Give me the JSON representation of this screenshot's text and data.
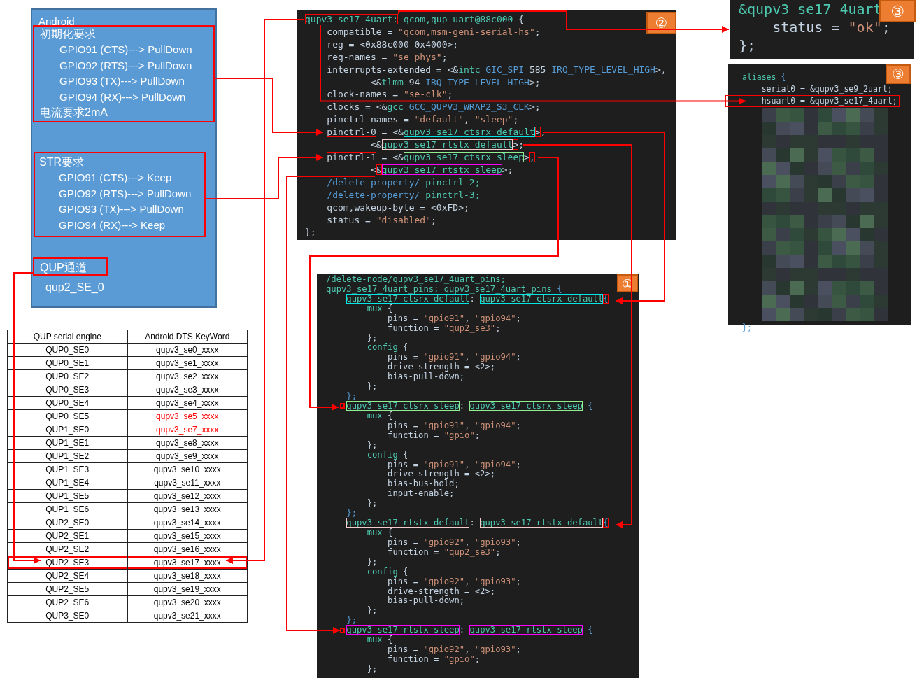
{
  "android_panel": {
    "title": "Android",
    "init_section": {
      "heading": "初期化要求",
      "items": [
        "GPIO91 (CTS)---> PullDown",
        "GPIO92 (RTS)---> PullDown",
        "GPIO93 (TX)---> PullDown",
        "GPIO94 (RX)---> PullDown"
      ],
      "footer": "电流要求2mA"
    },
    "str_section": {
      "heading": "STR要求",
      "items": [
        "GPIO91 (CTS)---> Keep",
        "GPIO92 (RTS)---> PullDown",
        "GPIO93 (TX)---> PullDown",
        "GPIO94 (RX)---> Keep"
      ]
    },
    "qup_label": "QUP通道",
    "qup_value": "qup2_SE_0"
  },
  "qup_table": {
    "columns": [
      "QUP serial engine",
      "Android DTS KeyWord"
    ],
    "rows": [
      {
        "engine": "QUP0_SE0",
        "keyword": "qupv3_se0_xxxx",
        "color": "#000000",
        "marked": false
      },
      {
        "engine": "QUP0_SE1",
        "keyword": "qupv3_se1_xxxx",
        "color": "#000000",
        "marked": false
      },
      {
        "engine": "QUP0_SE2",
        "keyword": "qupv3_se2_xxxx",
        "color": "#000000",
        "marked": false
      },
      {
        "engine": "QUP0_SE3",
        "keyword": "qupv3_se3_xxxx",
        "color": "#000000",
        "marked": false
      },
      {
        "engine": "QUP0_SE4",
        "keyword": "qupv3_se4_xxxx",
        "color": "#000000",
        "marked": false
      },
      {
        "engine": "QUP0_SE5",
        "keyword": "qupv3_se5_xxxx",
        "color": "#ff0000",
        "marked": false
      },
      {
        "engine": "QUP1_SE0",
        "keyword": "qupv3_se7_xxxx",
        "color": "#ff0000",
        "marked": false
      },
      {
        "engine": "QUP1_SE1",
        "keyword": "qupv3_se8_xxxx",
        "color": "#000000",
        "marked": false
      },
      {
        "engine": "QUP1_SE2",
        "keyword": "qupv3_se9_xxxx",
        "color": "#000000",
        "marked": false
      },
      {
        "engine": "QUP1_SE3",
        "keyword": "qupv3_se10_xxxx",
        "color": "#000000",
        "marked": false
      },
      {
        "engine": "QUP1_SE4",
        "keyword": "qupv3_se11_xxxx",
        "color": "#000000",
        "marked": false
      },
      {
        "engine": "QUP1_SE5",
        "keyword": "qupv3_se12_xxxx",
        "color": "#000000",
        "marked": false
      },
      {
        "engine": "QUP1_SE6",
        "keyword": "qupv3_se13_xxxx",
        "color": "#000000",
        "marked": false
      },
      {
        "engine": "QUP2_SE0",
        "keyword": "qupv3_se14_xxxx",
        "color": "#000000",
        "marked": false
      },
      {
        "engine": "QUP2_SE1",
        "keyword": "qupv3_se15_xxxx",
        "color": "#000000",
        "marked": false
      },
      {
        "engine": "QUP2_SE2",
        "keyword": "qupv3_se16_xxxx",
        "color": "#000000",
        "marked": false
      },
      {
        "engine": "QUP2_SE3",
        "keyword": "qupv3_se17_xxxx",
        "color": "#000000",
        "marked": true
      },
      {
        "engine": "QUP2_SE4",
        "keyword": "qupv3_se18_xxxx",
        "color": "#000000",
        "marked": false
      },
      {
        "engine": "QUP2_SE5",
        "keyword": "qupv3_se19_xxxx",
        "color": "#000000",
        "marked": false
      },
      {
        "engine": "QUP2_SE6",
        "keyword": "qupv3_se20_xxxx",
        "color": "#000000",
        "marked": false
      },
      {
        "engine": "QUP3_SE0",
        "keyword": "qupv3_se21_xxxx",
        "color": "#000000",
        "marked": false
      }
    ]
  },
  "uart_node_code": {
    "badge": "②",
    "lines": [
      [
        {
          "text": "qupv3_se17_4uart:",
          "kind": "id",
          "color": "#ff0000"
        },
        {
          "text": " qcom,qup_uart@88c000 ",
          "kind": "id"
        },
        {
          "text": "{",
          "kind": "plain"
        }
      ],
      [
        {
          "text": "    compatible = ",
          "kind": "plain"
        },
        {
          "text": "\"qcom,msm-geni-serial-hs\"",
          "kind": "str"
        },
        {
          "text": ";",
          "kind": "plain"
        }
      ],
      [
        {
          "text": "    reg = <0x88c000 0x4000>;",
          "kind": "plain"
        }
      ],
      [
        {
          "text": "    reg-names = ",
          "kind": "plain"
        },
        {
          "text": "\"se_phys\"",
          "kind": "str"
        },
        {
          "text": ";",
          "kind": "plain"
        }
      ],
      [
        {
          "text": "    interrupts-extended = <&",
          "kind": "plain"
        },
        {
          "text": "intc",
          "kind": "id"
        },
        {
          "text": " GIC_SPI ",
          "kind": "key"
        },
        {
          "text": "585",
          "kind": "plain"
        },
        {
          "text": " IRQ_TYPE_LEVEL_HIGH",
          "kind": "key"
        },
        {
          "text": ">,",
          "kind": "plain"
        }
      ],
      [
        {
          "text": "            <&",
          "kind": "plain"
        },
        {
          "text": "tlmm",
          "kind": "id"
        },
        {
          "text": " 94 ",
          "kind": "plain"
        },
        {
          "text": "IRQ_TYPE_LEVEL_HIGH",
          "kind": "key"
        },
        {
          "text": ">;",
          "kind": "plain"
        }
      ],
      [
        {
          "text": "    clock-names = ",
          "kind": "plain"
        },
        {
          "text": "\"se-clk\"",
          "kind": "str"
        },
        {
          "text": ";",
          "kind": "plain"
        }
      ],
      [
        {
          "text": "    clocks = <&",
          "kind": "plain"
        },
        {
          "text": "gcc",
          "kind": "id"
        },
        {
          "text": " GCC_QUPV3_WRAP2_S3_CLK",
          "kind": "key"
        },
        {
          "text": ">;",
          "kind": "plain"
        }
      ],
      [
        {
          "text": "    pinctrl-names = ",
          "kind": "plain"
        },
        {
          "text": "\"default\"",
          "kind": "str"
        },
        {
          "text": ", ",
          "kind": "plain"
        },
        {
          "text": "\"sleep\"",
          "kind": "str"
        },
        {
          "text": ";",
          "kind": "plain"
        }
      ],
      [
        {
          "kind": "gap"
        },
        {
          "text": "pinctrl-0",
          "kind": "plain",
          "color": "#ff0000"
        },
        {
          "text": " = <&",
          "kind": "plain"
        },
        {
          "text": "qupv3_se17_ctsrx_default",
          "kind": "id",
          "color": "#00e5e5"
        },
        {
          "text": ">",
          "kind": "plain",
          "color": "#ff0000"
        },
        {
          "text": ",",
          "kind": "plain"
        }
      ],
      [
        {
          "text": "            <&",
          "kind": "plain"
        },
        {
          "text": "qupv3_se17_rtstx_default",
          "kind": "id",
          "color": "#f4cccc"
        },
        {
          "text": ">",
          "kind": "plain",
          "color": "#ff0000"
        },
        {
          "text": ";",
          "kind": "plain"
        }
      ],
      [
        {
          "kind": "gap"
        },
        {
          "text": "pinctrl-1",
          "kind": "plain",
          "color": "#ff0000"
        },
        {
          "text": " = <&",
          "kind": "plain"
        },
        {
          "text": "qupv3_se17_ctsrx_sleep",
          "kind": "id",
          "color": "#90ee90"
        },
        {
          "text": ">",
          "kind": "plain"
        },
        {
          "text": ",",
          "kind": "plain",
          "color": "#ff0000"
        }
      ],
      [
        {
          "text": "            <",
          "kind": "plain"
        },
        {
          "text": "&",
          "kind": "plain",
          "color": "#ff0000"
        },
        {
          "text": "qupv3_se17_rtstx_sleep",
          "kind": "id",
          "color": "#ff00ff"
        },
        {
          "text": ">;",
          "kind": "plain"
        }
      ],
      [
        {
          "text": "    /delete-property/",
          "kind": "key"
        },
        {
          "text": " pinctrl-2;",
          "kind": "id"
        }
      ],
      [
        {
          "text": "    /delete-property/",
          "kind": "key"
        },
        {
          "text": " pinctrl-3;",
          "kind": "id"
        }
      ],
      [
        {
          "text": "    qcom,wakeup-byte = <0xFD>;",
          "kind": "plain"
        }
      ],
      [
        {
          "text": "    status = ",
          "kind": "plain"
        },
        {
          "text": "\"disabled\"",
          "kind": "str"
        },
        {
          "text": ";",
          "kind": "plain"
        }
      ],
      [
        {
          "text": "};",
          "kind": "plain"
        }
      ]
    ]
  },
  "status_snippet": {
    "badge": "③",
    "lines": [
      [
        {
          "text": "&qupv3_se17_4uart",
          "kind": "id"
        }
      ],
      [
        {
          "text": "    status = ",
          "kind": "plain"
        },
        {
          "text": "\"ok\"",
          "kind": "str"
        },
        {
          "text": ";",
          "kind": "plain"
        }
      ],
      [
        {
          "text": "};",
          "kind": "plain"
        }
      ]
    ]
  },
  "aliases_snippet": {
    "badge": "③",
    "lines": [
      [
        {
          "text": "aliases ",
          "kind": "id"
        },
        {
          "text": "{",
          "kind": "key"
        }
      ],
      [
        {
          "text": "    serial0 = &qupv3_se9_2uart;",
          "kind": "plain"
        }
      ],
      [
        {
          "text": "    hsuart0 = &qupv3_se17_4uart;",
          "kind": "plain",
          "color": "#ff0000"
        }
      ]
    ],
    "closing": "};"
  },
  "pins_code": {
    "badge": "①",
    "lines": [
      [
        {
          "text": "/delete-node/qupv3_se17_4uart_pins;",
          "kind": "id"
        }
      ],
      [
        {
          "text": "qupv3_se17_4uart_pins: qupv3_se17_4uart_pins ",
          "kind": "id"
        },
        {
          "text": "{",
          "kind": "key"
        }
      ],
      [
        {
          "kind": "gap"
        },
        {
          "text": "qupv3_se17_ctsrx_default",
          "kind": "id",
          "color": "#00e5e5"
        },
        {
          "text": ": ",
          "kind": "plain"
        },
        {
          "text": "qupv3_se17_ctsrx_default",
          "kind": "id",
          "color": "#00e5e5"
        },
        {
          "text": "{",
          "kind": "key",
          "color": "#ff0000"
        }
      ],
      [
        {
          "text": "        mux ",
          "kind": "id"
        },
        {
          "text": "{",
          "kind": "plain"
        }
      ],
      [
        {
          "text": "            pins = ",
          "kind": "plain"
        },
        {
          "text": "\"gpio91\"",
          "kind": "str"
        },
        {
          "text": ", ",
          "kind": "plain"
        },
        {
          "text": "\"gpio94\"",
          "kind": "str"
        },
        {
          "text": ";",
          "kind": "plain"
        }
      ],
      [
        {
          "text": "            function = ",
          "kind": "plain"
        },
        {
          "text": "\"qup2_se3\"",
          "kind": "str"
        },
        {
          "text": ";",
          "kind": "plain"
        }
      ],
      [
        {
          "text": "        };",
          "kind": "plain"
        }
      ],
      [
        {
          "text": "        config ",
          "kind": "id"
        },
        {
          "text": "{",
          "kind": "plain"
        }
      ],
      [
        {
          "text": "            pins = ",
          "kind": "plain"
        },
        {
          "text": "\"gpio91\"",
          "kind": "str"
        },
        {
          "text": ", ",
          "kind": "plain"
        },
        {
          "text": "\"gpio94\"",
          "kind": "str"
        },
        {
          "text": ";",
          "kind": "plain"
        }
      ],
      [
        {
          "text": "            drive-strength = <2>;",
          "kind": "plain"
        }
      ],
      [
        {
          "text": "            bias-pull-down;",
          "kind": "plain"
        }
      ],
      [
        {
          "text": "        };",
          "kind": "plain"
        }
      ],
      [
        {
          "text": "    };",
          "kind": "key"
        }
      ],
      [
        {
          "kind": "marker"
        },
        {
          "text": "qupv3_se17_ctsrx_sleep",
          "kind": "id",
          "color": "#90ee90"
        },
        {
          "text": ": ",
          "kind": "plain"
        },
        {
          "text": "qupv3_se17_ctsrx_sleep",
          "kind": "id",
          "color": "#90ee90"
        },
        {
          "text": " {",
          "kind": "key"
        }
      ],
      [
        {
          "text": "        mux ",
          "kind": "id"
        },
        {
          "text": "{",
          "kind": "plain"
        }
      ],
      [
        {
          "text": "            pins = ",
          "kind": "plain"
        },
        {
          "text": "\"gpio91\"",
          "kind": "str"
        },
        {
          "text": ", ",
          "kind": "plain"
        },
        {
          "text": "\"gpio94\"",
          "kind": "str"
        },
        {
          "text": ";",
          "kind": "plain"
        }
      ],
      [
        {
          "text": "            function = ",
          "kind": "plain"
        },
        {
          "text": "\"gpio\"",
          "kind": "str"
        },
        {
          "text": ";",
          "kind": "plain"
        }
      ],
      [
        {
          "text": "        };",
          "kind": "plain"
        }
      ],
      [
        {
          "text": "        config ",
          "kind": "id"
        },
        {
          "text": "{",
          "kind": "plain"
        }
      ],
      [
        {
          "text": "            pins = ",
          "kind": "plain"
        },
        {
          "text": "\"gpio91\"",
          "kind": "str"
        },
        {
          "text": ", ",
          "kind": "plain"
        },
        {
          "text": "\"gpio94\"",
          "kind": "str"
        },
        {
          "text": ";",
          "kind": "plain"
        }
      ],
      [
        {
          "text": "            drive-strength = <2>;",
          "kind": "plain"
        }
      ],
      [
        {
          "text": "            bias-bus-hold;",
          "kind": "plain"
        }
      ],
      [
        {
          "text": "            input-enable;",
          "kind": "plain"
        }
      ],
      [
        {
          "text": "        };",
          "kind": "plain"
        }
      ],
      [
        {
          "text": "    };",
          "kind": "key"
        }
      ],
      [
        {
          "kind": "gap"
        },
        {
          "text": "qupv3_se17_rtstx_default",
          "kind": "id",
          "color": "#f4cccc"
        },
        {
          "text": ": ",
          "kind": "plain"
        },
        {
          "text": "qupv3_se17_rtstx_default",
          "kind": "id",
          "color": "#f4cccc"
        },
        {
          "text": "{",
          "kind": "key",
          "color": "#ff0000"
        }
      ],
      [
        {
          "text": "        mux ",
          "kind": "id"
        },
        {
          "text": "{",
          "kind": "plain"
        }
      ],
      [
        {
          "text": "            pins = ",
          "kind": "plain"
        },
        {
          "text": "\"gpio92\"",
          "kind": "str"
        },
        {
          "text": ", ",
          "kind": "plain"
        },
        {
          "text": "\"gpio93\"",
          "kind": "str"
        },
        {
          "text": ";",
          "kind": "plain"
        }
      ],
      [
        {
          "text": "            function = ",
          "kind": "plain"
        },
        {
          "text": "\"qup2_se3\"",
          "kind": "str"
        },
        {
          "text": ";",
          "kind": "plain"
        }
      ],
      [
        {
          "text": "        };",
          "kind": "plain"
        }
      ],
      [
        {
          "text": "        config ",
          "kind": "id"
        },
        {
          "text": "{",
          "kind": "plain"
        }
      ],
      [
        {
          "text": "            pins = ",
          "kind": "plain"
        },
        {
          "text": "\"gpio92\"",
          "kind": "str"
        },
        {
          "text": ", ",
          "kind": "plain"
        },
        {
          "text": "\"gpio93\"",
          "kind": "str"
        },
        {
          "text": ";",
          "kind": "plain"
        }
      ],
      [
        {
          "text": "            drive-strength = <2>;",
          "kind": "plain"
        }
      ],
      [
        {
          "text": "            bias-pull-down;",
          "kind": "plain"
        }
      ],
      [
        {
          "text": "        };",
          "kind": "plain"
        }
      ],
      [
        {
          "text": "    };",
          "kind": "key"
        }
      ],
      [
        {
          "kind": "marker"
        },
        {
          "text": "qupv3_se17_rtstx_sleep",
          "kind": "id",
          "color": "#ff00ff"
        },
        {
          "text": ": ",
          "kind": "plain"
        },
        {
          "text": "qupv3_se17_rtstx_sleep",
          "kind": "id",
          "color": "#ff00ff"
        },
        {
          "text": " {",
          "kind": "key"
        }
      ],
      [
        {
          "text": "        mux ",
          "kind": "id"
        },
        {
          "text": "{",
          "kind": "plain"
        }
      ],
      [
        {
          "text": "            pins = ",
          "kind": "plain"
        },
        {
          "text": "\"gpio92\"",
          "kind": "str"
        },
        {
          "text": ", ",
          "kind": "plain"
        },
        {
          "text": "\"gpio93\"",
          "kind": "str"
        },
        {
          "text": ";",
          "kind": "plain"
        }
      ],
      [
        {
          "text": "            function = ",
          "kind": "plain"
        },
        {
          "text": "\"gpio\"",
          "kind": "str"
        },
        {
          "text": ";",
          "kind": "plain"
        }
      ],
      [
        {
          "text": "        };",
          "kind": "plain"
        }
      ]
    ]
  }
}
